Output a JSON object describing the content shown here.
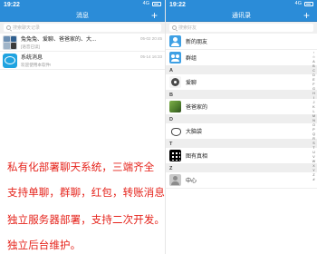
{
  "left": {
    "status": {
      "time": "19:22",
      "network": "4G"
    },
    "title": "消息",
    "plus": "+",
    "search_placeholder": "搜索聊天记录",
    "messages": [
      {
        "title": "兔兔兔、爱聊、爸爸家的、大...",
        "preview": "[语音已读]",
        "time": "05-02 20:45"
      },
      {
        "title": "系统消息",
        "preview": "欢迎使用本软件!",
        "time": "05-14 16:33"
      }
    ],
    "promo_lines": [
      "私有化部署聊天系统，三端齐全",
      "支持单聊，群聊，红包，转账消息",
      "独立服务器部署，支持二次开发。",
      "独立后台维护。"
    ]
  },
  "right": {
    "status": {
      "time": "19:22",
      "network": "4G"
    },
    "title": "通讯录",
    "plus": "+",
    "search_placeholder": "搜索好友",
    "top_items": [
      {
        "name": "新的朋友",
        "icon": "new-friend-icon"
      },
      {
        "name": "群组",
        "icon": "group-icon"
      }
    ],
    "sections": [
      {
        "letter": "A",
        "items": [
          {
            "name": "爱聊"
          }
        ]
      },
      {
        "letter": "B",
        "items": [
          {
            "name": "爸爸家的"
          }
        ]
      },
      {
        "letter": "D",
        "items": [
          {
            "name": "大脑袋"
          }
        ]
      },
      {
        "letter": "T",
        "items": [
          {
            "name": "图有真相"
          }
        ]
      },
      {
        "letter": "Z",
        "items": [
          {
            "name": "中心"
          }
        ]
      }
    ],
    "index_letters": [
      "↑",
      "☆",
      "A",
      "B",
      "C",
      "D",
      "E",
      "F",
      "G",
      "H",
      "I",
      "J",
      "K",
      "L",
      "M",
      "N",
      "O",
      "P",
      "Q",
      "R",
      "S",
      "T",
      "U",
      "V",
      "W",
      "X",
      "Y",
      "Z",
      "#"
    ]
  }
}
